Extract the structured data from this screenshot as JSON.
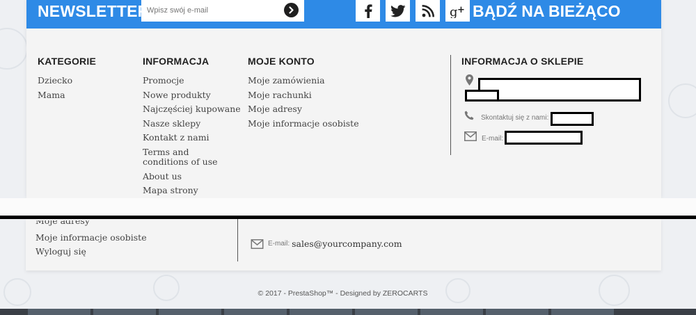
{
  "newsletter": {
    "title": "NEWSLETTER",
    "email_placeholder": "Wpisz swój e-mail",
    "submit_icon": "arrow-right-icon"
  },
  "social": {
    "title": "BĄDŹ NA BIEŻĄCO",
    "icons": [
      "facebook-icon",
      "twitter-icon",
      "rss-icon",
      "google-plus-icon"
    ]
  },
  "categories": {
    "title": "KATEGORIE",
    "items": [
      "Dziecko",
      "Mama"
    ]
  },
  "information": {
    "title": "INFORMACJA",
    "items": [
      "Promocje",
      "Nowe produkty",
      "Najczęściej kupowane",
      "Nasze sklepy",
      "Kontakt z nami",
      "Terms and conditions of use",
      "About us",
      "Mapa strony"
    ]
  },
  "account": {
    "title": "MOJE KONTO",
    "items": [
      "Moje zamówienia",
      "Moje rachunki",
      "Moje adresy",
      "Moje informacje osobiste"
    ]
  },
  "store": {
    "title": "INFORMACJA O SKLEPIE",
    "contact_label": "Skontaktuj się z nami:",
    "email_label": "E-mail:"
  },
  "bottom": {
    "account_items": [
      "Moje adresy",
      "Moje informacje osobiste",
      "Wyloguj się"
    ],
    "email_label": "E-mail:",
    "email_value": "sales@yourcompany.com"
  },
  "footer": {
    "copyright": "© 2017 - PrestaShop™ - Designed by ZEROCARTS"
  },
  "colors": {
    "accent": "#2e8ae6",
    "panel": "#f4f4f4"
  }
}
